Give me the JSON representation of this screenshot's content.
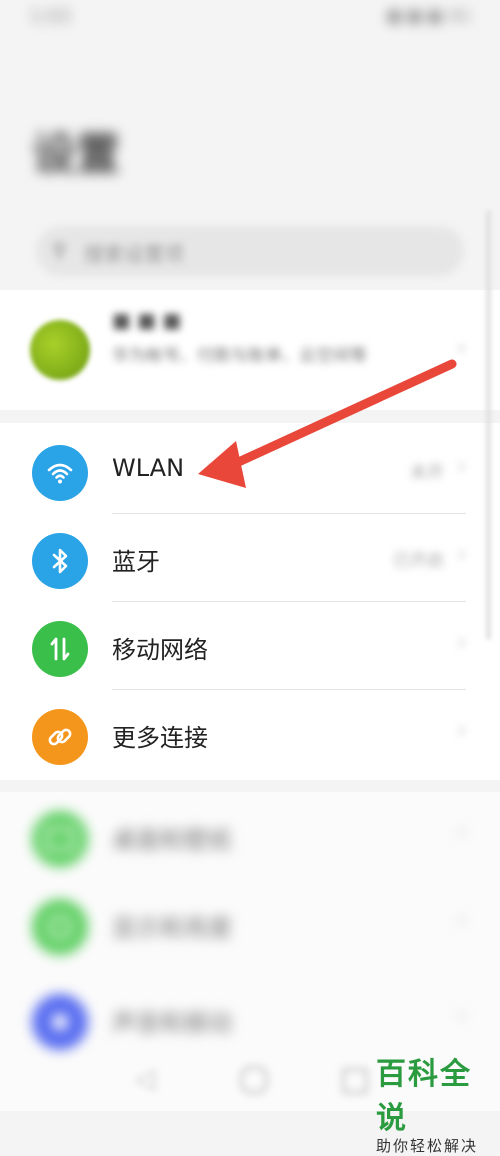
{
  "status_bar": {
    "left_text": "1:03",
    "right_text": "■ ■ ■ 4G"
  },
  "title": "设置",
  "search": {
    "placeholder": "搜索设置项"
  },
  "profile": {
    "name": "■ ■ ■",
    "description": "华为帐号、付款与账单、云空间等"
  },
  "connect_items": [
    {
      "id": "wlan",
      "label": "WLAN",
      "value": "未开",
      "icon": "wifi-icon",
      "color": "#2aa4e6"
    },
    {
      "id": "bluetooth",
      "label": "蓝牙",
      "value": "已开启",
      "icon": "bluetooth-icon",
      "color": "#2aa4e6"
    },
    {
      "id": "mobile-network",
      "label": "移动网络",
      "value": "",
      "icon": "data-transfer-icon",
      "color": "#3bbf4b"
    },
    {
      "id": "more-connections",
      "label": "更多连接",
      "value": "",
      "icon": "link-icon",
      "color": "#f5961c"
    }
  ],
  "display_items": [
    {
      "id": "desktop-wallpaper",
      "label": "桌面和壁纸",
      "icon": "image-icon",
      "color": "#5fcf63"
    },
    {
      "id": "display-brightness",
      "label": "显示和亮度",
      "icon": "brightness-icon",
      "color": "#5fcf63"
    },
    {
      "id": "sound-vibration",
      "label": "声音和振动",
      "icon": "speaker-icon",
      "color": "#5a6ef0"
    }
  ],
  "watermark": {
    "title": "百科全说",
    "subtitle": "助你轻松解决"
  },
  "annotation": {
    "arrow_color": "#e8473a"
  }
}
